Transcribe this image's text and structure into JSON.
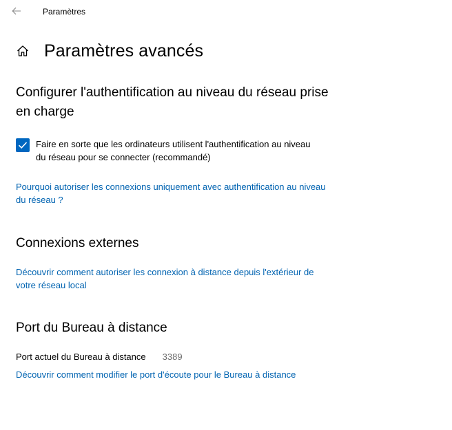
{
  "window": {
    "title": "Paramètres",
    "back_icon": "back-arrow-icon"
  },
  "page": {
    "title": "Paramètres avancés",
    "home_icon": "home-icon"
  },
  "nla": {
    "heading": "Configurer l'authentification au niveau du réseau prise en charge",
    "checkbox_label": "Faire en sorte que les ordinateurs utilisent l'authentification au niveau du réseau pour se connecter (recommandé)",
    "checkbox_checked": true,
    "link": "Pourquoi autoriser les connexions uniquement avec authentification au niveau du réseau ?"
  },
  "external": {
    "heading": "Connexions externes",
    "link": "Découvrir comment autoriser les connexion à distance depuis l'extérieur de votre réseau local"
  },
  "port": {
    "heading": "Port du Bureau à distance",
    "label": "Port actuel du Bureau à distance",
    "value": "3389",
    "link": "Découvrir comment modifier le port d'écoute pour le Bureau à distance"
  },
  "colors": {
    "accent": "#0067c0",
    "link": "#0063b1",
    "muted_text": "#6d6d6d"
  }
}
